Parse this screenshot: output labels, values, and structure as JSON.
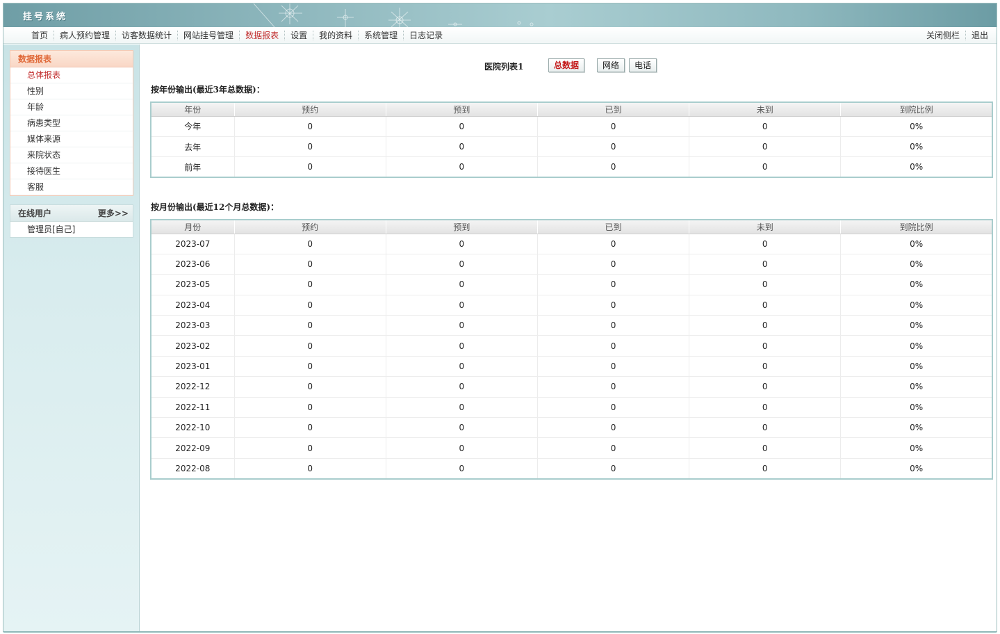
{
  "app": {
    "title": "挂号系统"
  },
  "nav": {
    "items": [
      {
        "label": "首页"
      },
      {
        "label": "病人预约管理"
      },
      {
        "label": "访客数据统计"
      },
      {
        "label": "网站挂号管理"
      },
      {
        "label": "数据报表"
      },
      {
        "label": "设置"
      },
      {
        "label": "我的资料"
      },
      {
        "label": "系统管理"
      },
      {
        "label": "日志记录"
      }
    ],
    "active_index": 4,
    "right": {
      "close_sidebar": "关闭侧栏",
      "logout": "退出"
    }
  },
  "sidebar": {
    "report_panel": {
      "title": "数据报表",
      "items": [
        {
          "label": "总体报表"
        },
        {
          "label": "性别"
        },
        {
          "label": "年龄"
        },
        {
          "label": "病患类型"
        },
        {
          "label": "媒体来源"
        },
        {
          "label": "来院状态"
        },
        {
          "label": "接待医生"
        },
        {
          "label": "客服"
        }
      ]
    },
    "online_panel": {
      "title": "在线用户",
      "more": "更多>>",
      "users": [
        {
          "label": "管理员[自己]"
        }
      ]
    }
  },
  "main": {
    "hospital_label": "医院列表1",
    "buttons": {
      "total": "总数据",
      "web": "网络",
      "phone": "电话"
    },
    "yearly": {
      "title": "按年份输出(最近3年总数据)：",
      "columns": [
        "年份",
        "预约",
        "预到",
        "已到",
        "未到",
        "到院比例"
      ],
      "rows": [
        [
          "今年",
          "0",
          "0",
          "0",
          "0",
          "0%"
        ],
        [
          "去年",
          "0",
          "0",
          "0",
          "0",
          "0%"
        ],
        [
          "前年",
          "0",
          "0",
          "0",
          "0",
          "0%"
        ]
      ]
    },
    "monthly": {
      "title": "按月份输出(最近12个月总数据)：",
      "columns": [
        "月份",
        "预约",
        "预到",
        "已到",
        "未到",
        "到院比例"
      ],
      "rows": [
        [
          "2023-07",
          "0",
          "0",
          "0",
          "0",
          "0%"
        ],
        [
          "2023-06",
          "0",
          "0",
          "0",
          "0",
          "0%"
        ],
        [
          "2023-05",
          "0",
          "0",
          "0",
          "0",
          "0%"
        ],
        [
          "2023-04",
          "0",
          "0",
          "0",
          "0",
          "0%"
        ],
        [
          "2023-03",
          "0",
          "0",
          "0",
          "0",
          "0%"
        ],
        [
          "2023-02",
          "0",
          "0",
          "0",
          "0",
          "0%"
        ],
        [
          "2023-01",
          "0",
          "0",
          "0",
          "0",
          "0%"
        ],
        [
          "2022-12",
          "0",
          "0",
          "0",
          "0",
          "0%"
        ],
        [
          "2022-11",
          "0",
          "0",
          "0",
          "0",
          "0%"
        ],
        [
          "2022-10",
          "0",
          "0",
          "0",
          "0",
          "0%"
        ],
        [
          "2022-09",
          "0",
          "0",
          "0",
          "0",
          "0%"
        ],
        [
          "2022-08",
          "0",
          "0",
          "0",
          "0",
          "0%"
        ]
      ]
    }
  },
  "colors": {
    "accent_red": "#c23030",
    "banner_teal": "#8fb8be",
    "table_border": "#a9cdcd"
  }
}
